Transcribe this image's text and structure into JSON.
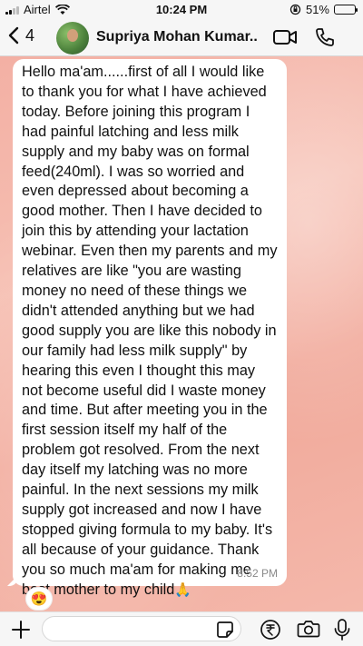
{
  "status_bar": {
    "carrier": "Airtel",
    "time": "10:24 PM",
    "battery": "51%",
    "battery_level": 0.51
  },
  "header": {
    "back_count": "4",
    "contact_name": "Supriya Mohan Kumar..."
  },
  "message": {
    "text": "Hello ma'am......first of all I would like to thank you for what I have achieved today. Before joining this program I had painful latching and less milk supply and my baby was on formal feed(240ml). I was so worried and even depressed about becoming a good mother. Then I have decided to join this by attending your lactation webinar. Even then my parents and my relatives are like \"you are wasting money no need of these things we didn't attended anything but we had good supply you are like this nobody in our family had less milk supply\" by hearing this even I thought this may not become useful did I waste money and time. But after meeting you in the first session itself my half of the problem got resolved. From the next day itself my latching was no more painful. In the next sessions my milk supply got increased and now I have stopped giving formula to my baby. It's all because of your guidance. Thank you so much ma'am for making me best mother to my child",
    "end_emoji": "🙏",
    "time": "8:52 PM",
    "reaction": "😍"
  },
  "input": {
    "value": "",
    "placeholder": ""
  },
  "icons": {
    "back": "chevron-left-icon",
    "video": "video-call-icon",
    "phone": "phone-icon",
    "plus": "plus-icon",
    "sticker": "sticker-icon",
    "payment": "rupee-payment-icon",
    "camera": "camera-icon",
    "mic": "microphone-icon"
  },
  "colors": {
    "chat_background": "#f3b0a4",
    "bubble": "#ffffff",
    "battery_fill": "#f2c300"
  }
}
